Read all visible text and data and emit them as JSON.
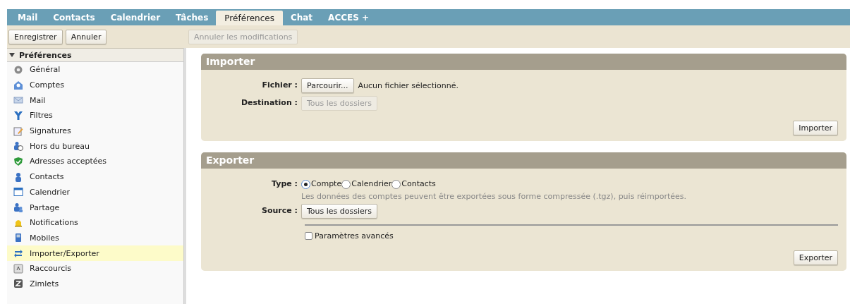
{
  "tabs": [
    {
      "label": "Mail",
      "selected": false
    },
    {
      "label": "Contacts",
      "selected": false
    },
    {
      "label": "Calendrier",
      "selected": false
    },
    {
      "label": "Tâches",
      "selected": false
    },
    {
      "label": "Préférences",
      "selected": true
    },
    {
      "label": "Chat",
      "selected": false
    },
    {
      "label": "ACCES +",
      "selected": false
    }
  ],
  "toolbar": [
    {
      "label": "Enregistrer",
      "disabled": false
    },
    {
      "label": "Annuler",
      "disabled": false
    },
    {
      "label": "Annuler les modifications",
      "disabled": true
    }
  ],
  "sidebar": {
    "header": "Préférences",
    "expanded": true,
    "items": [
      {
        "label": "Général",
        "selected": false
      },
      {
        "label": "Comptes",
        "selected": false
      },
      {
        "label": "Mail",
        "selected": false
      },
      {
        "label": "Filtres",
        "selected": false
      },
      {
        "label": "Signatures",
        "selected": false
      },
      {
        "label": "Hors du bureau",
        "selected": false
      },
      {
        "label": "Adresses acceptées",
        "selected": false
      },
      {
        "label": "Contacts",
        "selected": false
      },
      {
        "label": "Calendrier",
        "selected": false
      },
      {
        "label": "Partage",
        "selected": false
      },
      {
        "label": "Notifications",
        "selected": false
      },
      {
        "label": "Mobiles",
        "selected": false
      },
      {
        "label": "Importer/Exporter",
        "selected": true
      },
      {
        "label": "Raccourcis",
        "selected": false
      },
      {
        "label": "Zimlets",
        "selected": false
      }
    ]
  },
  "import": {
    "title": "Importer",
    "file_label": "Fichier :",
    "browse_button": "Parcourir...",
    "file_status": "Aucun fichier sélectionné.",
    "destination_label": "Destination :",
    "destination_button": {
      "label": "Tous les dossiers",
      "disabled": true
    },
    "action_button": "Importer"
  },
  "export": {
    "title": "Exporter",
    "type_label": "Type :",
    "types": [
      {
        "label": "Compte",
        "selected": true
      },
      {
        "label": "Calendrier",
        "selected": false
      },
      {
        "label": "Contacts",
        "selected": false
      }
    ],
    "hint": "Les données des comptes peuvent être exportées sous forme compressée (.tgz), puis réimportées.",
    "source_label": "Source :",
    "source_button": {
      "label": "Tous les dossiers",
      "disabled": false
    },
    "advanced": {
      "label": "Paramètres avancés",
      "checked": false
    },
    "action_button": "Exporter"
  }
}
